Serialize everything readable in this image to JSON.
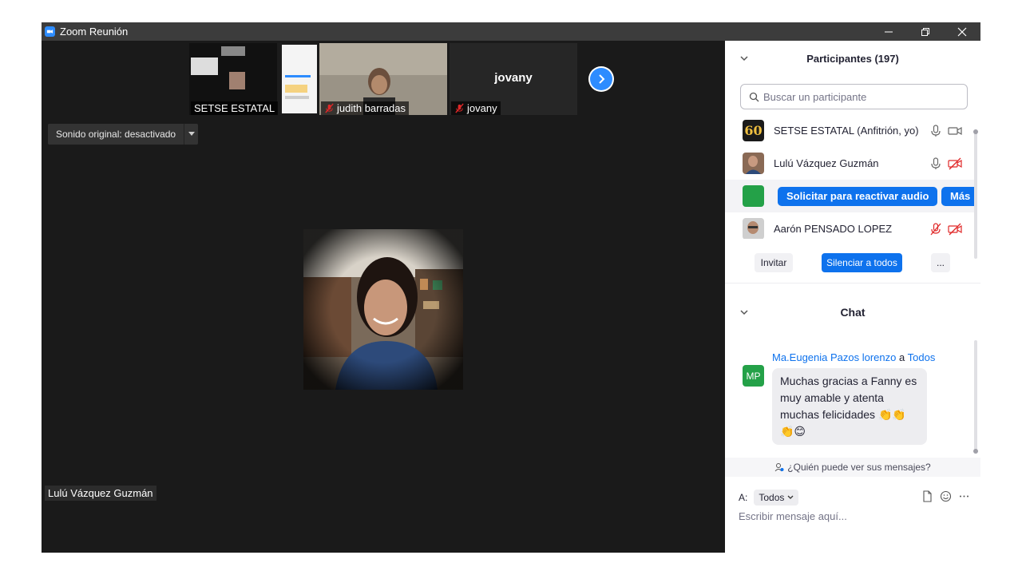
{
  "window": {
    "title": "Zoom Reunión"
  },
  "stage": {
    "thumbnails": [
      {
        "name": "SETSE ESTATAL",
        "muted": false
      },
      {
        "name": "judith barradas",
        "muted": true
      },
      {
        "name": "jovany",
        "muted": true,
        "display_name": "jovany"
      }
    ],
    "sound_toggle": "Sonido original: desactivado",
    "active_speaker": "Lulú Vázquez Guzmán"
  },
  "participants": {
    "header": "Participantes (197)",
    "search_placeholder": "Buscar un participante",
    "list": [
      {
        "name": "SETSE ESTATAL (Anfitrión, yo)",
        "avatar_label": "60"
      },
      {
        "name": "Lulú Vázquez Guzmán"
      },
      {
        "request_button": "Solicitar para reactivar audio",
        "more_button": "Más"
      },
      {
        "name": "Aarón PENSADO LOPEZ"
      }
    ],
    "buttons": {
      "invite": "Invitar",
      "mute_all": "Silenciar a todos",
      "more": "..."
    }
  },
  "chat": {
    "header": "Chat",
    "messages": [
      {
        "sender": "Ma.Eugenia Pazos lorenzo",
        "connector": "a",
        "recipient": "Todos",
        "avatar": "MP",
        "text": "Muchas gracias a Fanny es muy amable y atenta muchas felicidades 👏👏👏😊"
      }
    ],
    "who_can_see": "¿Quién puede ver sus mensajes?",
    "to_label": "A:",
    "to_value": "Todos",
    "input_placeholder": "Escribir mensaje aquí..."
  },
  "colors": {
    "accent": "#0e72ed",
    "avatar_green": "#24a148",
    "muted_red": "#e02828"
  }
}
